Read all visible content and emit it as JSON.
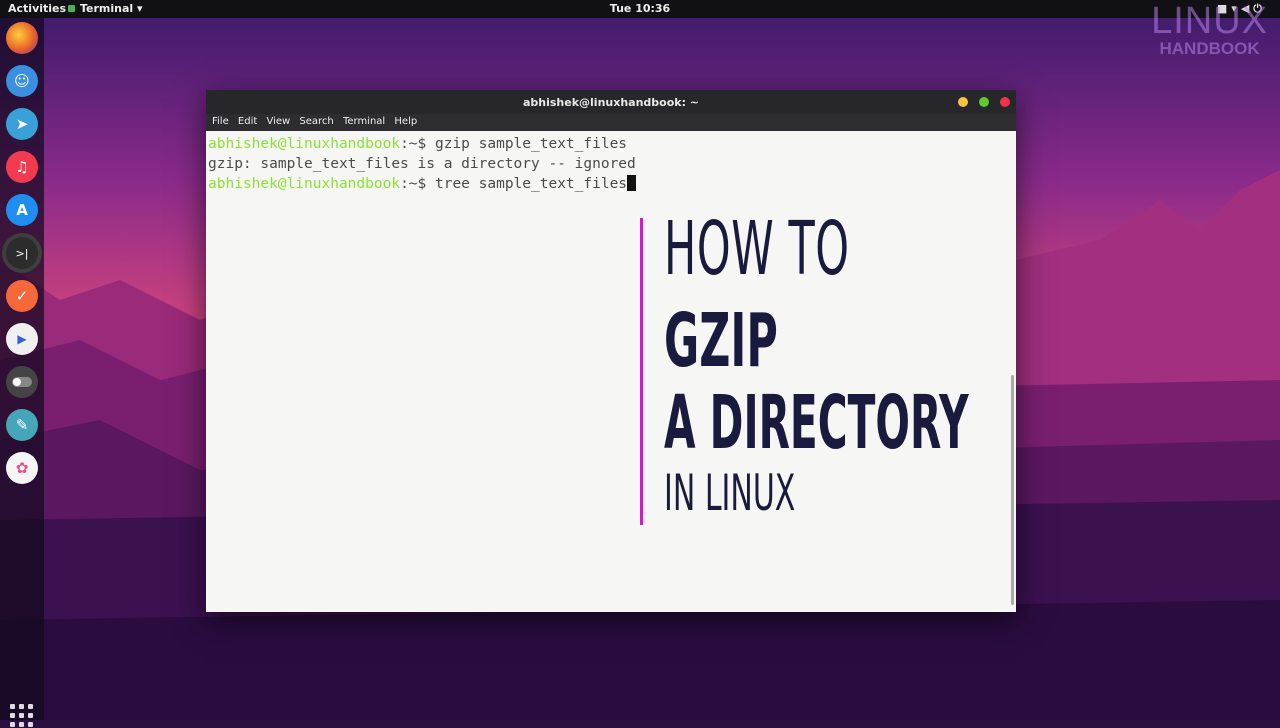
{
  "topbar": {
    "activities": "Activities",
    "app_menu": "Terminal ▾",
    "clock": "Tue 10:36"
  },
  "watermark": {
    "line1": "LINUX",
    "line2": "HANDBOOK"
  },
  "dock": {
    "items": [
      {
        "name": "firefox",
        "glyph": ""
      },
      {
        "name": "finder",
        "glyph": "☺"
      },
      {
        "name": "telegram",
        "glyph": "➤"
      },
      {
        "name": "music",
        "glyph": "♫"
      },
      {
        "name": "app-store",
        "glyph": "A"
      },
      {
        "name": "terminal",
        "glyph": ">|"
      },
      {
        "name": "tasks",
        "glyph": "✓"
      },
      {
        "name": "media-player",
        "glyph": "▶"
      },
      {
        "name": "toggle",
        "glyph": ""
      },
      {
        "name": "text-editor",
        "glyph": "✎"
      },
      {
        "name": "photos",
        "glyph": "✿"
      }
    ],
    "colors": {
      "firefox": "#e8632a",
      "finder": "#3b8fe0",
      "telegram": "#3aa0d8",
      "music": "#f23b50",
      "app-store": "#1e8ff0",
      "terminal": "#2c2c2c",
      "tasks": "#f4683c",
      "media-player": "#f0f0f0",
      "toggle": "#444444",
      "text-editor": "#44a6b8",
      "photos": "#f5f5f5"
    }
  },
  "window": {
    "title": "abhishek@linuxhandbook: ~",
    "menu": [
      "File",
      "Edit",
      "View",
      "Search",
      "Terminal",
      "Help"
    ]
  },
  "terminal": {
    "lines": [
      {
        "prompt": "abhishek@linuxhandbook",
        "path": ":~$ ",
        "cmd": "gzip sample_text_files"
      },
      {
        "output": "gzip: sample_text_files is a directory -- ignored"
      },
      {
        "prompt": "abhishek@linuxhandbook",
        "path": ":~$ ",
        "cmd": "tree sample_text_files"
      }
    ]
  },
  "overlay": {
    "line1": "HOW TO",
    "line2": "GZIP",
    "line3": "A DIRECTORY",
    "line4": "IN LINUX",
    "accent": "#d616d2"
  }
}
